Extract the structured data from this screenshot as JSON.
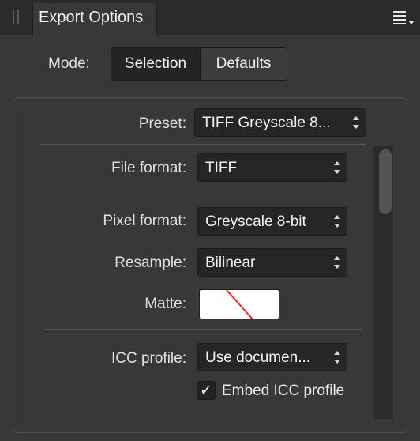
{
  "panel": {
    "tab_title": "Export Options",
    "grip_icon": "drag-handle-icon",
    "menu_icon": "hamburger-menu-icon"
  },
  "mode": {
    "label": "Mode:",
    "options": [
      "Selection",
      "Defaults"
    ],
    "selected": "Selection"
  },
  "settings": {
    "preset": {
      "label": "Preset:",
      "value": "TIFF Greyscale 8..."
    },
    "file_format": {
      "label": "File format:",
      "value": "TIFF"
    },
    "pixel_format": {
      "label": "Pixel format:",
      "value": "Greyscale 8-bit"
    },
    "resample": {
      "label": "Resample:",
      "value": "Bilinear"
    },
    "matte": {
      "label": "Matte:",
      "value_icon": "no-color-swatch-icon"
    },
    "icc_profile": {
      "label": "ICC profile:",
      "value": "Use documen..."
    },
    "embed_icc": {
      "label": "Embed ICC profile",
      "checked": true
    }
  },
  "colors": {
    "panel_bg": "#383838",
    "tabbar_bg": "#2b2b2b",
    "control_bg": "#262626",
    "swatch_slash": "#e0302a"
  }
}
